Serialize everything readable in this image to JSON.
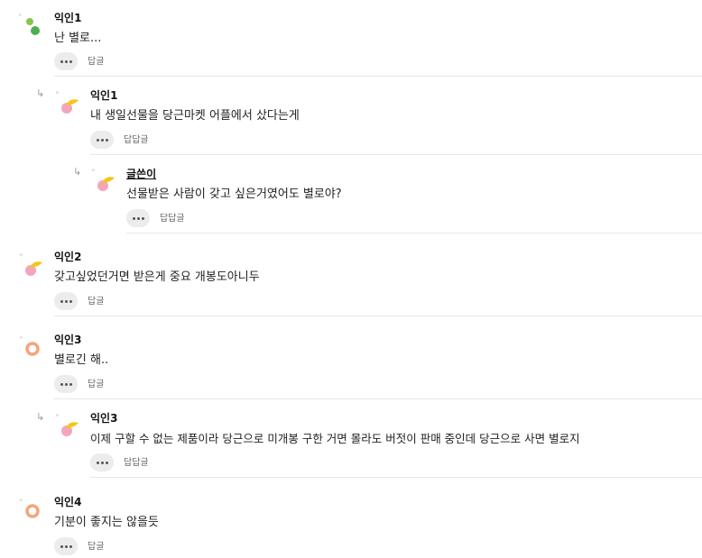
{
  "more_icon": "more-horizontal-icon",
  "reply_arrow_icon": "reply-arrow-icon",
  "tiny_mark": "ᵒ",
  "comments": [
    {
      "author": "익인1",
      "text": "난 별로...",
      "reply_label": "답글",
      "avatar": "green-dots"
    },
    {
      "author": "익인1",
      "text": "내 생일선물을 당근마켓 어플에서 샀다는게",
      "reply_label": "답답글",
      "avatar": "yellow-pink"
    },
    {
      "author": "글쓴이",
      "text": "선물받은 사람이 갖고 싶은거였어도 별로야?",
      "reply_label": "답답글",
      "avatar": "yellow-pink"
    },
    {
      "author": "익인2",
      "text": "갖고싶었던거면 받은게 중요 개봉도아니두",
      "reply_label": "답글",
      "avatar": "yellow-pink"
    },
    {
      "author": "익인3",
      "text": "별로긴 해..",
      "reply_label": "답글",
      "avatar": "orange-ring"
    },
    {
      "author": "익인3",
      "text": "이제 구할 수 없는 제품이라 당근으로 미개봉 구한 거면 몰라도 버젓이 판매 중인데 당근으로 사면 별로지",
      "reply_label": "답답글",
      "avatar": "yellow-pink"
    },
    {
      "author": "익인4",
      "text": "기분이 좋지는 않을듯",
      "reply_label": "답글",
      "avatar": "orange-ring"
    }
  ],
  "colors": {
    "green_light": "#8bc34a",
    "green_dark": "#4caf50",
    "yellow": "#f5c518",
    "pink": "#f4a6b8",
    "orange": "#f4a57a"
  }
}
